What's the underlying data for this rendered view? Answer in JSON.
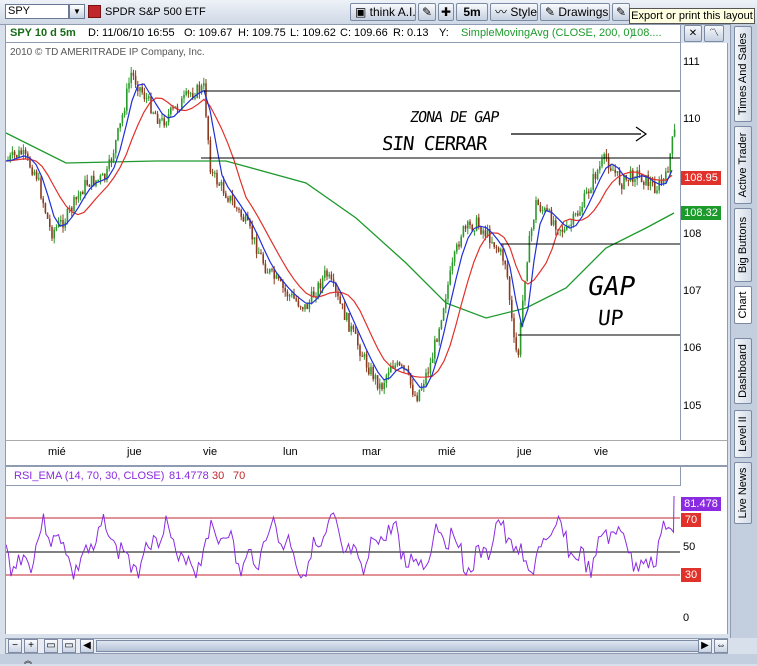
{
  "toolbar": {
    "symbol": "SPY",
    "description": "SPDR S&P 500 ETF",
    "think_label": "think A.I.",
    "interval_label": "5m",
    "style_label": "Style",
    "drawings_label": "Drawings",
    "tooltip": "Export or print this layout"
  },
  "header": {
    "title": "SPY 10 d 5m",
    "date": "D: 11/06/10 16:55",
    "open": "O: 109.67",
    "high": "H: 109.75",
    "low": "L: 109.62",
    "close": "C: 109.66",
    "range": "R: 0.13",
    "y": "Y:",
    "study": "SimpleMovingAvg (CLOSE, 200, 0)",
    "study_value": "108...."
  },
  "copyright": "2010 © TD AMERITRADE IP Company, Inc.",
  "price_axis": [
    "111",
    "110",
    "109",
    "108",
    "107",
    "106",
    "105"
  ],
  "price_tags": [
    {
      "value": "108.95",
      "color": "#e0312a"
    },
    {
      "value": "108.32",
      "color": "#1d9a2c"
    }
  ],
  "x_labels": [
    "mié",
    "jue",
    "vie",
    "lun",
    "mar",
    "mié",
    "jue",
    "vie"
  ],
  "annotations": {
    "zone_text": "ZONA DE GAP",
    "sin_cerrar_text": "SIN CERRAR",
    "gap_text": "GAP",
    "up_text": "UP"
  },
  "rsi": {
    "label": "RSI_EMA (14, 70, 30, CLOSE)",
    "value": "81.4778",
    "ob": "30",
    "os": "70",
    "axis": [
      "50",
      "0"
    ],
    "value_tag": "81.478",
    "tag_70": "70",
    "tag_30": "30"
  },
  "sidebar_tabs": [
    "Times And Sales",
    "Active Trader",
    "Big Buttons",
    "Chart",
    "Dashboard",
    "Level II",
    "Live News"
  ],
  "colors": {
    "sma_green": "#1d9a2c",
    "ema_red": "#e0312a",
    "ma_blue": "#1f2fd8",
    "rsi_purple": "#8a2be2",
    "candle_up": "#2a9a2a",
    "candle_down": "#8b3a1e"
  }
}
